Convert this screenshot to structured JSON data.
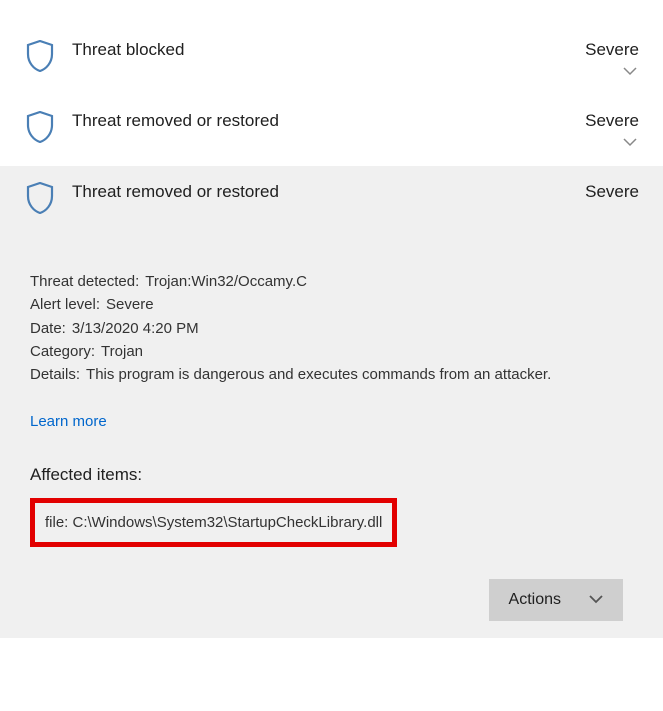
{
  "threats": [
    {
      "title": "Threat blocked",
      "severity": "Severe"
    },
    {
      "title": "Threat removed or restored",
      "severity": "Severe"
    },
    {
      "title": "Threat removed or restored",
      "severity": "Severe"
    }
  ],
  "details": {
    "threatDetected": {
      "label": "Threat detected:",
      "value": "Trojan:Win32/Occamy.C"
    },
    "alertLevel": {
      "label": "Alert level:",
      "value": "Severe"
    },
    "date": {
      "label": "Date:",
      "value": "3/13/2020 4:20 PM"
    },
    "category": {
      "label": "Category:",
      "value": "Trojan"
    },
    "detailsText": {
      "label": "Details:",
      "value": "This program is dangerous and executes commands from an attacker."
    }
  },
  "learnMore": "Learn more",
  "affectedItemsTitle": "Affected items:",
  "affectedItem": "file: C:\\Windows\\System32\\StartupCheckLibrary.dll",
  "actionsLabel": "Actions"
}
